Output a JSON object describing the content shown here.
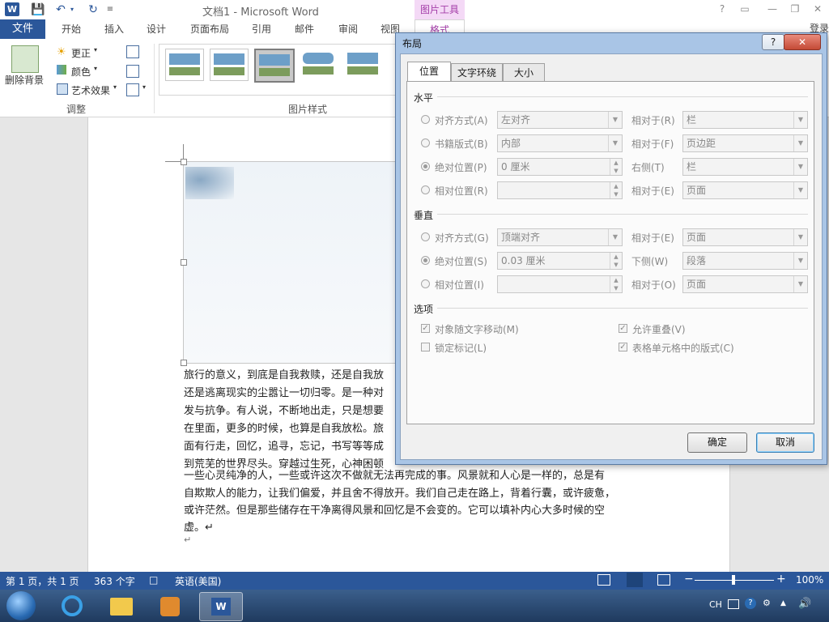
{
  "titlebar": {
    "logo": "W",
    "title": "文档1 - Microsoft Word",
    "picture_tools": "图片工具",
    "signin": "登录"
  },
  "tabs": {
    "file": "文件",
    "items": [
      "开始",
      "插入",
      "设计",
      "页面布局",
      "引用",
      "邮件",
      "审阅",
      "视图"
    ],
    "format": "格式"
  },
  "ribbon": {
    "remove_bg": "删除背景",
    "corrections": "更正",
    "color": "颜色",
    "artistic": "艺术效果",
    "adjust_group": "调整",
    "styles_group": "图片样式"
  },
  "document": {
    "lines": [
      "旅行的意义，到底是自我救赎，还是自我放",
      "还是逃离现实的尘嚣让一切归零。是一种对",
      "发与抗争。有人说，不断地出走，只是想要",
      "在里面，更多的时候，也算是自我放松。旅",
      "面有行走，回忆，追寻，忘记，书写等等成",
      "到荒芜的世界尽头。穿越过生死，心神困顿",
      "一些心灵纯净的人，一些或许这次不做就无法再完成的事。风景就和人心是一样的，总是有",
      "自欺欺人的能力，让我们偏爱，并且舍不得放开。我们自己走在路上，背着行囊，或许疲惫，",
      "或许茫然。但是那些储存在干净离得风景和回忆是不会变的。它可以填补内心大多时候的空",
      "虚。↵",
      "↵"
    ]
  },
  "statusbar": {
    "page": "第 1 页，共 1 页",
    "words": "363 个字",
    "language": "英语(美国)",
    "zoom": "100%"
  },
  "taskbar": {
    "tray_lang": "CH"
  },
  "dialog": {
    "title": "布局",
    "help": "?",
    "close": "✕",
    "tabs": [
      "位置",
      "文字环绕",
      "大小"
    ],
    "horizontal": {
      "heading": "水平",
      "rows": [
        {
          "label": "对齐方式(A)",
          "value": "左对齐",
          "rel_label": "相对于(R)",
          "rel_value": "栏",
          "kind": "combo",
          "selected": false
        },
        {
          "label": "书籍版式(B)",
          "value": "内部",
          "rel_label": "相对于(F)",
          "rel_value": "页边距",
          "kind": "combo",
          "selected": false
        },
        {
          "label": "绝对位置(P)",
          "value": "0 厘米",
          "rel_label": "右侧(T)",
          "rel_value": "栏",
          "kind": "spin",
          "selected": true
        },
        {
          "label": "相对位置(R)",
          "value": "",
          "rel_label": "相对于(E)",
          "rel_value": "页面",
          "kind": "spin",
          "selected": false
        }
      ]
    },
    "vertical": {
      "heading": "垂直",
      "rows": [
        {
          "label": "对齐方式(G)",
          "value": "顶端对齐",
          "rel_label": "相对于(E)",
          "rel_value": "页面",
          "kind": "combo",
          "selected": false
        },
        {
          "label": "绝对位置(S)",
          "value": "0.03 厘米",
          "rel_label": "下侧(W)",
          "rel_value": "段落",
          "kind": "spin",
          "selected": true
        },
        {
          "label": "相对位置(I)",
          "value": "",
          "rel_label": "相对于(O)",
          "rel_value": "页面",
          "kind": "spin",
          "selected": false
        }
      ]
    },
    "options": {
      "heading": "选项",
      "move_with_text": "对象随文字移动(M)",
      "move_with_text_checked": true,
      "lock_anchor": "锁定标记(L)",
      "lock_anchor_checked": false,
      "allow_overlap": "允许重叠(V)",
      "allow_overlap_checked": true,
      "layout_in_cell": "表格单元格中的版式(C)",
      "layout_in_cell_checked": true
    },
    "ok": "确定",
    "cancel": "取消"
  }
}
